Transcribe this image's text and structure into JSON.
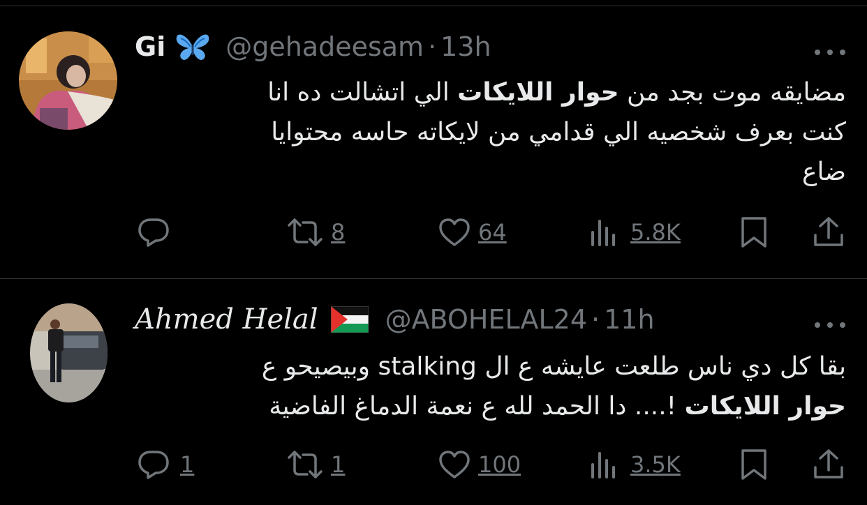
{
  "tweets": [
    {
      "display_name": "Gi",
      "name_emoji": "🦋",
      "handle": "@gehadeesam",
      "separator": "·",
      "time": "13h",
      "lines": [
        {
          "before": "مضايقه موت بجد من ",
          "bold": "حوار اللايكات",
          "after": " الي اتشالت ده انا"
        },
        {
          "before": "كنت بعرف شخصيه الي قدامي من لايكاته حاسه محتوايا",
          "bold": "",
          "after": ""
        },
        {
          "before": "ضاع",
          "bold": "",
          "after": ""
        }
      ],
      "replies": "",
      "reposts": "8",
      "likes": "64",
      "views": "5.8K"
    },
    {
      "display_name": "Ahmed Helal",
      "name_emoji": "palestine-flag",
      "handle": "@ABOHELAL24",
      "separator": "·",
      "time": "11h",
      "lines": [
        {
          "before": "بقا كل دي ناس طلعت عايشه ع ال stalking وبيصيحو ع",
          "bold": "",
          "after": ""
        },
        {
          "before": "",
          "bold": "حوار اللايكات",
          "after": " !.... دا الحمد لله ع نعمة الدماغ الفاضية"
        }
      ],
      "replies": "1",
      "reposts": "1",
      "likes": "100",
      "views": "3.5K"
    }
  ],
  "colors": {
    "background": "#000000",
    "text": "#e7e9ea",
    "muted": "#71767b",
    "divider": "#2f3336"
  },
  "icons": [
    "butterfly-emoji",
    "palestine-flag-icon",
    "reply-icon",
    "repost-icon",
    "like-icon",
    "views-icon",
    "bookmark-icon",
    "share-icon",
    "more-icon"
  ]
}
